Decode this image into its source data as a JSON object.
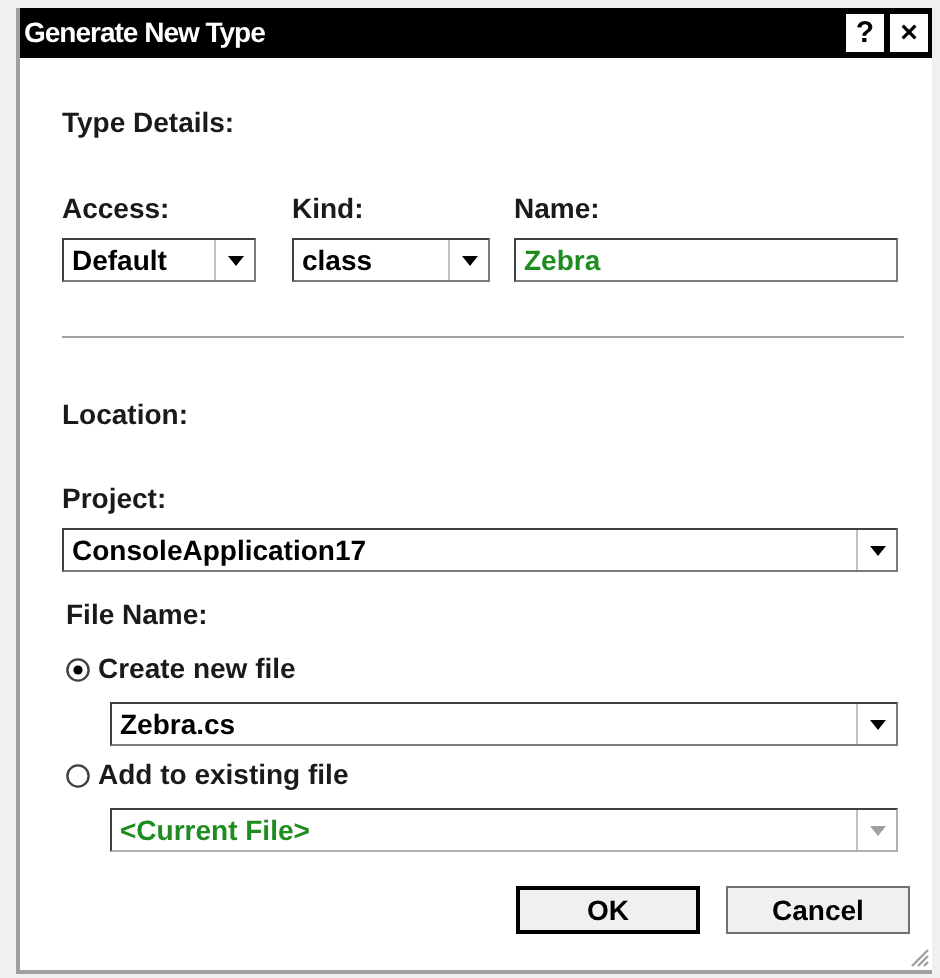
{
  "window": {
    "title": "Generate New Type",
    "title_buttons": [
      "?",
      "×"
    ]
  },
  "type_details": {
    "heading": "Type Details:",
    "access": {
      "label": "Access:",
      "value": "Default"
    },
    "kind": {
      "label": "Kind:",
      "value": "class"
    },
    "name": {
      "label": "Name:",
      "value": "Zebra"
    }
  },
  "location": {
    "heading": "Location:",
    "project": {
      "label": "Project:",
      "value": "ConsoleApplication17"
    },
    "file_name": {
      "label": "File Name:",
      "options": [
        {
          "label": "Create new file",
          "selected": true,
          "value": "Zebra.cs",
          "disabled": false
        },
        {
          "label": "Add to existing file",
          "selected": false,
          "value": "<Current File>",
          "disabled": true
        }
      ]
    }
  },
  "buttons": [
    {
      "label": "OK",
      "default": true
    },
    {
      "label": "Cancel",
      "default": false
    }
  ]
}
